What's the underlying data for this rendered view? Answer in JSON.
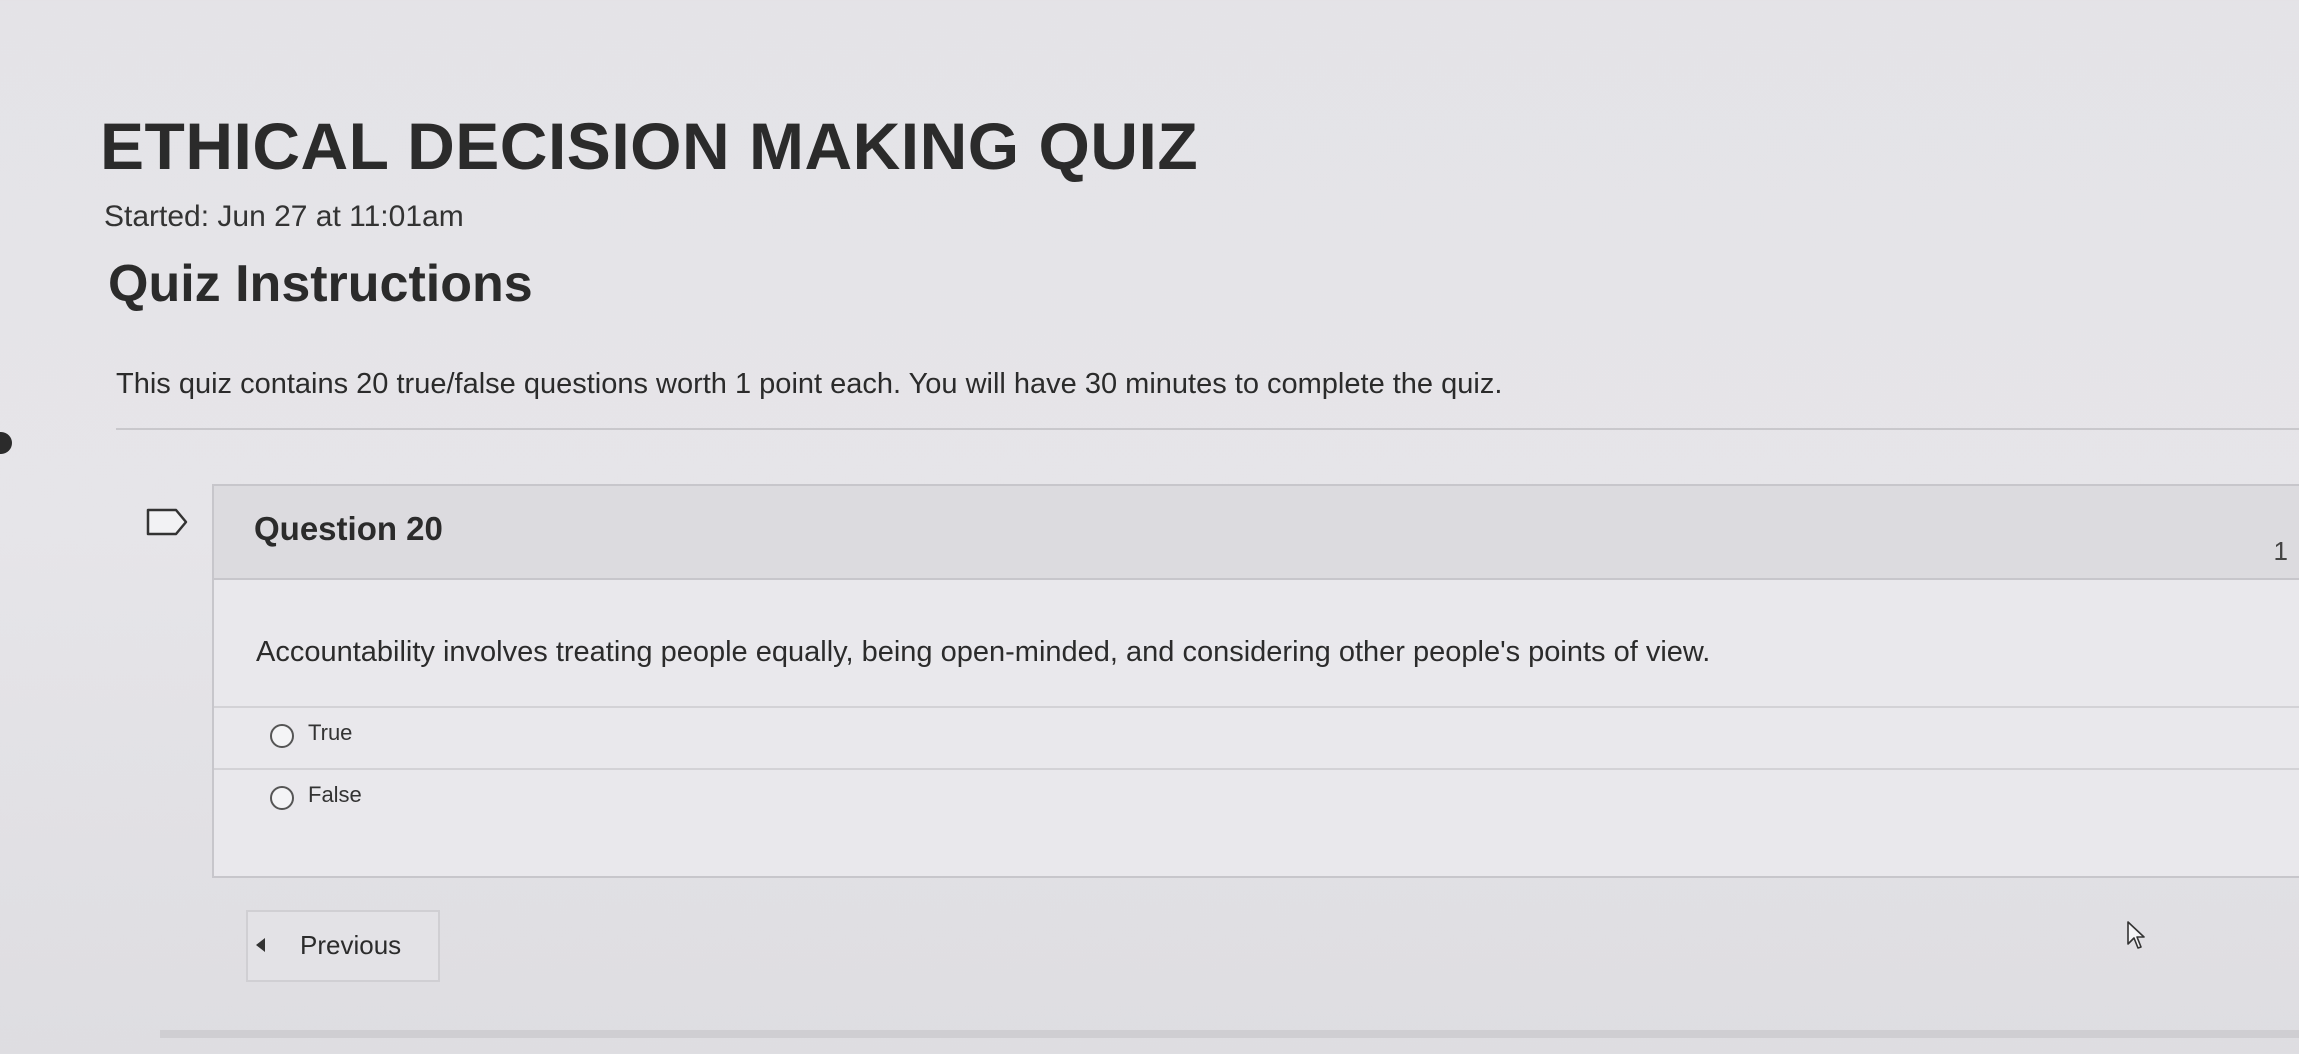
{
  "quiz": {
    "title": "ETHICAL DECISION MAKING QUIZ",
    "started": "Started: Jun 27 at 11:01am"
  },
  "instructions": {
    "heading": "Quiz Instructions",
    "text": "This quiz contains 20 true/false questions worth 1 point each. You will have 30 minutes to complete the quiz."
  },
  "question": {
    "label": "Question 20",
    "points": "1",
    "text": "Accountability involves treating people equally, being open-minded, and considering other people's points of view.",
    "answers": [
      {
        "label": "True",
        "selected": false
      },
      {
        "label": "False",
        "selected": false
      }
    ]
  },
  "navigation": {
    "previous_label": "Previous"
  },
  "icons": {
    "flag": "flag-question-icon",
    "previous": "chevron-left-icon",
    "cursor": "mouse-pointer-icon"
  }
}
